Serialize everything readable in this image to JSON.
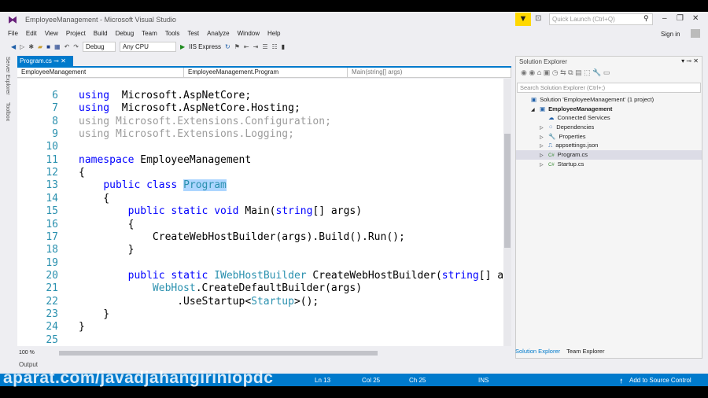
{
  "window": {
    "title": "EmployeeManagement - Microsoft Visual Studio",
    "quick_launch": "Quick Launch (Ctrl+Q)",
    "sign_in": "Sign in"
  },
  "menu": [
    "File",
    "Edit",
    "View",
    "Project",
    "Build",
    "Debug",
    "Team",
    "Tools",
    "Test",
    "Analyze",
    "Window",
    "Help"
  ],
  "toolbar": {
    "config": "Debug",
    "platform": "Any CPU",
    "run": "IIS Express"
  },
  "side_tabs": [
    "Server Explorer",
    "Toolbox"
  ],
  "editor": {
    "tab": "Program.cs",
    "nav_project": "EmployeeManagement",
    "nav_class": "EmployeeManagement.Program",
    "nav_member": "Main(string[] args)",
    "zoom": "100 %",
    "lines": [
      {
        "n": "6",
        "t": [
          [
            "kw",
            "using"
          ],
          [
            "",
            "  Microsoft.AspNetCore;"
          ]
        ]
      },
      {
        "n": "7",
        "t": [
          [
            "kw",
            "using"
          ],
          [
            "",
            "  Microsoft.AspNetCore.Hosting;"
          ]
        ]
      },
      {
        "n": "8",
        "t": [
          [
            "gr",
            "using Microsoft.Extensions.Configuration;"
          ]
        ]
      },
      {
        "n": "9",
        "t": [
          [
            "gr",
            "using Microsoft.Extensions.Logging;"
          ]
        ]
      },
      {
        "n": "10",
        "t": []
      },
      {
        "n": "11",
        "t": [
          [
            "kw",
            "namespace"
          ],
          [
            "",
            " EmployeeManagement"
          ]
        ]
      },
      {
        "n": "12",
        "t": [
          [
            "",
            "{"
          ]
        ]
      },
      {
        "n": "13",
        "t": [
          [
            "",
            "    "
          ],
          [
            "kw",
            "public class"
          ],
          [
            "",
            " "
          ],
          [
            "sel ty",
            "Program"
          ]
        ]
      },
      {
        "n": "14",
        "t": [
          [
            "",
            "    {"
          ]
        ]
      },
      {
        "n": "15",
        "t": [
          [
            "",
            "        "
          ],
          [
            "kw",
            "public static void"
          ],
          [
            "",
            " Main("
          ],
          [
            "kw",
            "string"
          ],
          [
            "",
            "[] args)"
          ]
        ]
      },
      {
        "n": "16",
        "t": [
          [
            "",
            "        {"
          ]
        ]
      },
      {
        "n": "17",
        "t": [
          [
            "",
            "            CreateWebHostBuilder(args).Build().Run();"
          ]
        ]
      },
      {
        "n": "18",
        "t": [
          [
            "",
            "        }"
          ]
        ]
      },
      {
        "n": "19",
        "t": []
      },
      {
        "n": "20",
        "t": [
          [
            "",
            "        "
          ],
          [
            "kw",
            "public static"
          ],
          [
            "",
            " "
          ],
          [
            "ty",
            "IWebHostBuilder"
          ],
          [
            "",
            " CreateWebHostBuilder("
          ],
          [
            "kw",
            "string"
          ],
          [
            "",
            "[] args) =>"
          ]
        ]
      },
      {
        "n": "21",
        "t": [
          [
            "",
            "            "
          ],
          [
            "ty",
            "WebHost"
          ],
          [
            "",
            ".CreateDefaultBuilder(args)"
          ]
        ]
      },
      {
        "n": "22",
        "t": [
          [
            "",
            "                .UseStartup<"
          ],
          [
            "ty",
            "Startup"
          ],
          [
            "",
            ">();"
          ]
        ]
      },
      {
        "n": "23",
        "t": [
          [
            "",
            "    }"
          ]
        ]
      },
      {
        "n": "24",
        "t": [
          [
            "",
            "}"
          ]
        ]
      },
      {
        "n": "25",
        "t": []
      }
    ]
  },
  "output_label": "Output",
  "solution_explorer": {
    "title": "Solution Explorer",
    "search": "Search Solution Explorer (Ctrl+;)",
    "items": [
      {
        "label": "Solution 'EmployeeManagement' (1 project)",
        "icon": "solution-icon",
        "level": 0,
        "exp": ""
      },
      {
        "label": "EmployeeManagement",
        "icon": "project-icon",
        "level": 1,
        "exp": "◢",
        "bold": true
      },
      {
        "label": "Connected Services",
        "icon": "cloud-icon",
        "level": 2,
        "exp": ""
      },
      {
        "label": "Dependencies",
        "icon": "dependencies-icon",
        "level": 2,
        "exp": "▷"
      },
      {
        "label": "Properties",
        "icon": "wrench-icon",
        "level": 2,
        "exp": "▷"
      },
      {
        "label": "appsettings.json",
        "icon": "json-file-icon",
        "level": 2,
        "exp": "▷"
      },
      {
        "label": "Program.cs",
        "icon": "csharp-file-icon",
        "level": 2,
        "exp": "▷",
        "hl": true
      },
      {
        "label": "Startup.cs",
        "icon": "csharp-file-icon",
        "level": 2,
        "exp": "▷"
      }
    ],
    "tabs": [
      "Solution Explorer",
      "Team Explorer"
    ]
  },
  "status": {
    "ln": "Ln 13",
    "col": "Col 25",
    "ch": "Ch 25",
    "mode": "INS",
    "source_control": "Add to Source Control"
  },
  "watermark": "aparat.com/javadjahangiriniopdc",
  "colors": {
    "accent": "#007acc",
    "keyword": "#0000ff",
    "type": "#2b91af"
  }
}
